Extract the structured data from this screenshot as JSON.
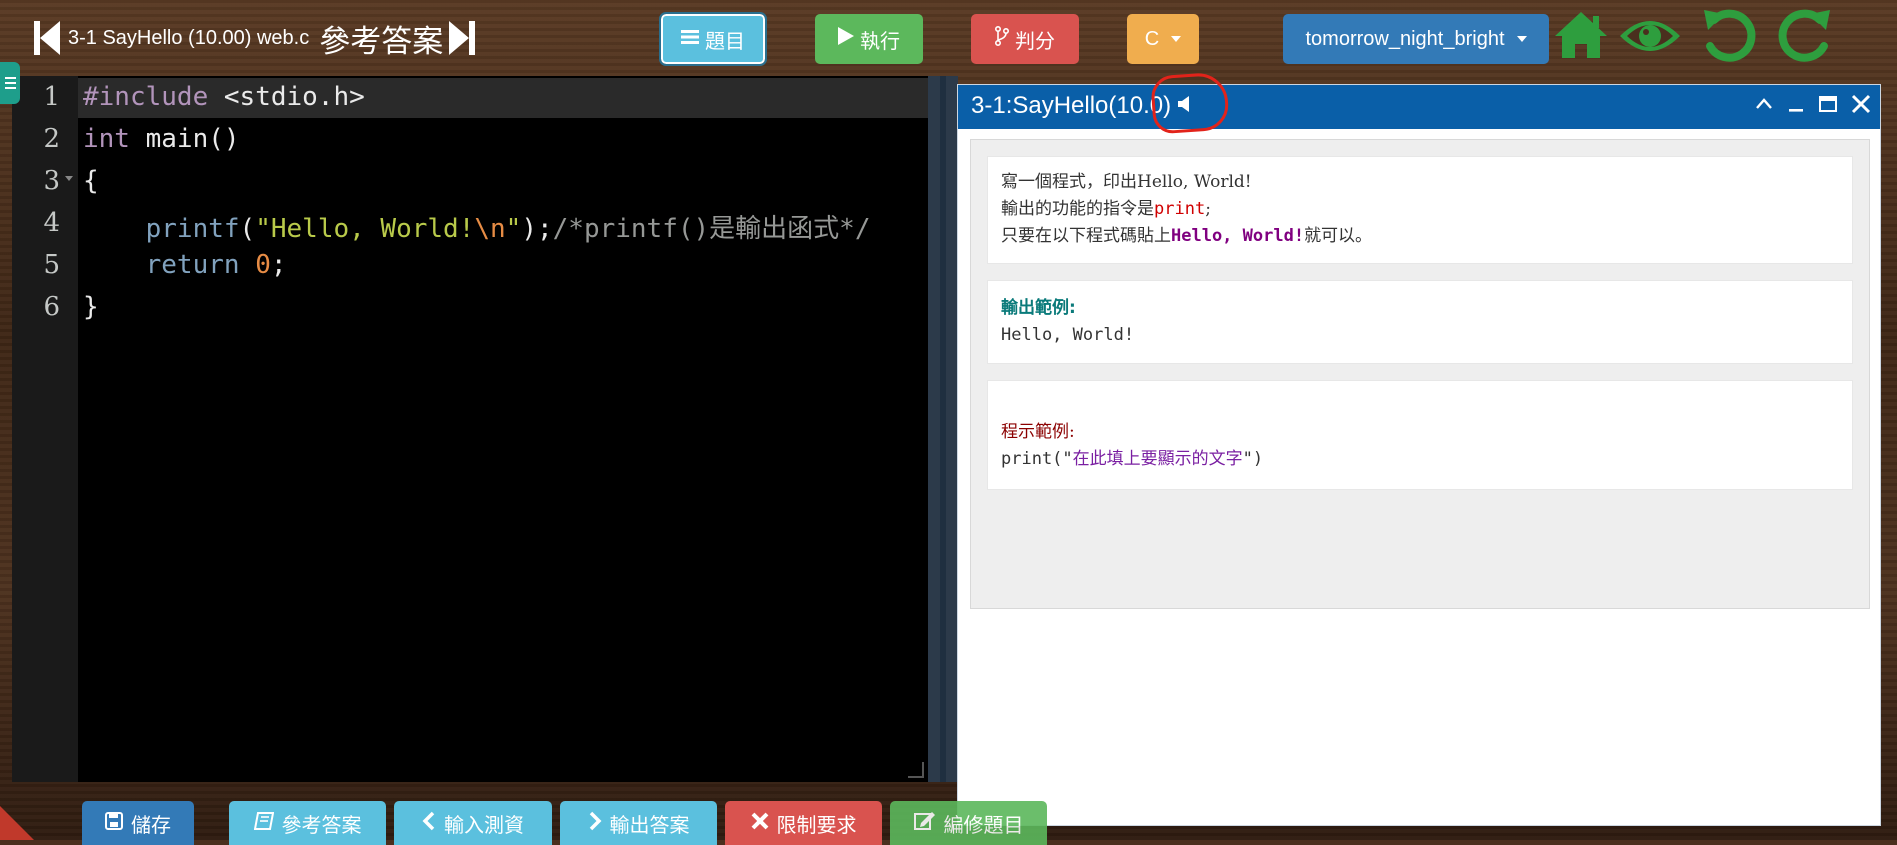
{
  "window": {
    "title": "3-1 SayHello (10.00) web.c",
    "title_suffix": "參考答案"
  },
  "toolbar": {
    "topic_label": "題目",
    "run_label": "執行",
    "grade_label": "判分",
    "lang_label": "C",
    "theme_label": "tomorrow_night_bright"
  },
  "editor": {
    "lines": [
      {
        "no": "1"
      },
      {
        "no": "2"
      },
      {
        "no": "3"
      },
      {
        "no": "4"
      },
      {
        "no": "5"
      },
      {
        "no": "6"
      }
    ],
    "code": {
      "l1_inc": "#include",
      "l1_rest": " <stdio.h>",
      "l2_kw": "int",
      "l2_rest": " main()",
      "l3": "{",
      "l4_indent": "    ",
      "l4_fn": "printf",
      "l4_open": "(",
      "l4_str1": "\"Hello, World!",
      "l4_esc": "\\n",
      "l4_str2": "\"",
      "l4_close": ");",
      "l4_comment": "/*printf()是輸出函式*/",
      "l5_indent": "    ",
      "l5_kw": "return",
      "l5_num": "0",
      "l5_end": ";",
      "l6": "}"
    }
  },
  "problem": {
    "title": "3-1:SayHello(10.0)",
    "desc": {
      "line1": "寫一個程式，印出Hello, World!",
      "line2_a": "輸出的功能的指令是",
      "line2_b": "print",
      "line2_c": ";",
      "line3_a": "只要在以下程式碼貼上",
      "line3_b": "Hello, World!",
      "line3_c": "就可以。"
    },
    "output": {
      "heading": "輸出範例:",
      "text": "Hello, World!"
    },
    "example": {
      "heading": "程示範例:",
      "code_a": "print(\"",
      "code_b": "在此填上要顯示的文字",
      "code_c": "\")"
    }
  },
  "bottom": {
    "save": "儲存",
    "answer": "參考答案",
    "input": "輸入測資",
    "output": "輸出答案",
    "limit": "限制要求",
    "edit": "編修題目"
  },
  "colors": {
    "topic": "#5bc0de",
    "run": "#5cb85c",
    "grade": "#d9534f",
    "lang": "#f0ad4e",
    "theme": "#337ab7",
    "window_header": "#0a5fa8",
    "home_icon": "#2e9e3e",
    "highlight": "#e2231a"
  },
  "icons": [
    "skip-back-icon",
    "list-icon",
    "play-icon",
    "branch-icon",
    "home-icon",
    "eye-icon",
    "undo-icon",
    "redo-icon",
    "speaker-icon",
    "chevron-up-icon",
    "minimize-icon",
    "maximize-icon",
    "close-icon",
    "save-icon",
    "book-icon",
    "chevron-left-icon",
    "chevron-right-icon",
    "x-icon",
    "edit-icon"
  ]
}
